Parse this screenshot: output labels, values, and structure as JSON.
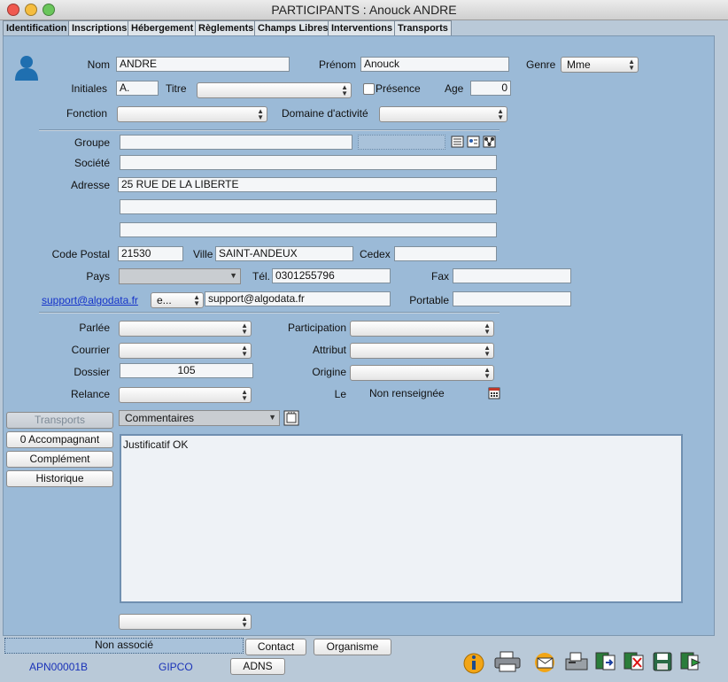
{
  "window": {
    "title": "PARTICIPANTS : Anouck ANDRE"
  },
  "tabs": [
    "Identification",
    "Inscriptions",
    "Hébergement",
    "Règlements",
    "Champs Libres",
    "Interventions",
    "Transports"
  ],
  "identity": {
    "nom_label": "Nom",
    "nom": "ANDRE",
    "prenom_label": "Prénom",
    "prenom": "Anouck",
    "genre_label": "Genre",
    "genre": "Mme",
    "initiales_label": "Initiales",
    "initiales": "A.",
    "titre_label": "Titre",
    "titre": "",
    "presence_label": "Présence",
    "age_label": "Age",
    "age": "0",
    "fonction_label": "Fonction",
    "fonction": "",
    "domaine_label": "Domaine d'activité",
    "domaine": ""
  },
  "address": {
    "groupe_label": "Groupe",
    "groupe": "",
    "societe_label": "Société",
    "societe": "",
    "adresse_label": "Adresse",
    "adresse1": "25 RUE DE LA LIBERTE",
    "adresse2": "",
    "adresse3": "",
    "cp_label": "Code Postal",
    "cp": "21530",
    "ville_label": "Ville",
    "ville": "SAINT-ANDEUX",
    "cedex_label": "Cedex",
    "cedex": "",
    "pays_label": "Pays",
    "pays": "",
    "tel_label": "Tél.",
    "tel": "0301255796",
    "fax_label": "Fax",
    "fax": "",
    "email_link": "support@algodata.fr",
    "email_type": "e...",
    "email": "support@algodata.fr",
    "portable_label": "Portable",
    "portable": ""
  },
  "extra": {
    "parlee_label": "Parlée",
    "parlee": "",
    "courrier_label": "Courrier",
    "courrier": "",
    "dossier_label": "Dossier",
    "dossier": "105",
    "relance_label": "Relance",
    "relance": "",
    "participation_label": "Participation",
    "participation": "",
    "attribut_label": "Attribut",
    "attribut": "",
    "origine_label": "Origine",
    "origine": "",
    "le_label": "Le",
    "le": "Non renseignée"
  },
  "side_buttons": {
    "transports": "Transports",
    "accompagnant": "0 Accompagnant",
    "complement": "Complément",
    "historique": "Historique"
  },
  "notes": {
    "type": "Commentaires",
    "text": "Justificatif OK",
    "bottom_select": ""
  },
  "footer": {
    "association": "Non associé",
    "contact": "Contact",
    "organisme": "Organisme",
    "adns": "ADNS",
    "code": "APN00001B",
    "org": "GIPCO"
  },
  "icons": [
    "user-icon",
    "info-icon",
    "printer-icon",
    "mail-icon",
    "fax-icon",
    "export-icon",
    "delete-icon",
    "save-icon",
    "next-icon"
  ]
}
